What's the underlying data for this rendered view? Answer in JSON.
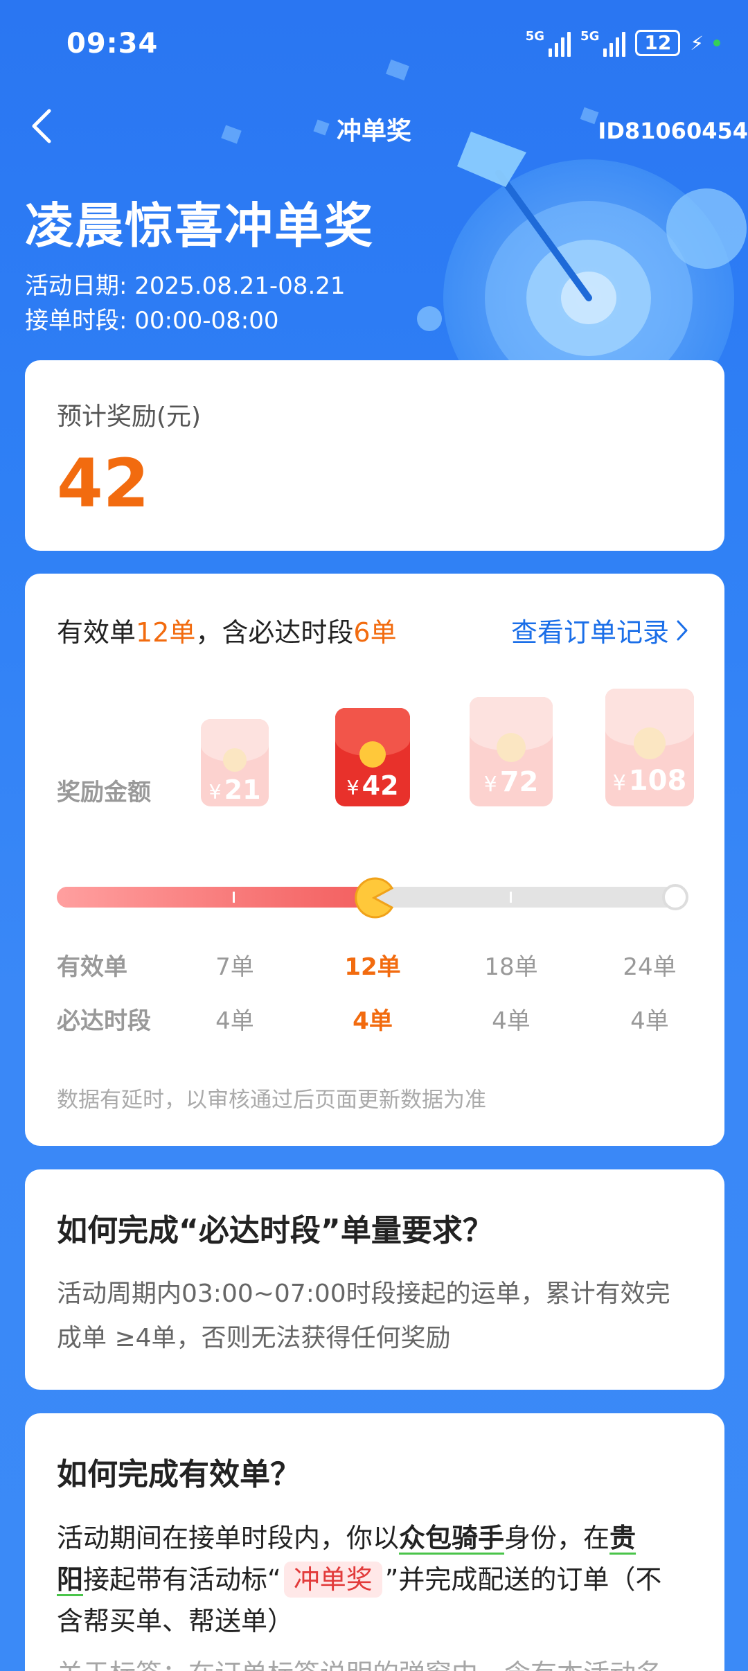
{
  "status_bar": {
    "time": "09:34",
    "signal1_label": "5G",
    "signal2_label": "5G",
    "battery": "12"
  },
  "nav": {
    "title": "冲单奖",
    "id_text": "ID81060454"
  },
  "hero": {
    "title": "凌晨惊喜冲单奖",
    "date_line": "活动日期: 2025.08.21-08.21",
    "period_line": "接单时段: 00:00-08:00"
  },
  "reward": {
    "label": "预计奖励(元)",
    "value": "42"
  },
  "progress": {
    "head_prefix": "有效单",
    "valid_count": "12单",
    "head_mid": "，含必达时段",
    "must_count": "6单",
    "order_link": "查看订单记录",
    "reward_row_label": "奖励金额",
    "valid_row_label": "有效单",
    "must_row_label": "必达时段",
    "current_fraction": 0.5,
    "tiers": [
      {
        "amount": "21",
        "valid": "7单",
        "must": "4单",
        "active": false
      },
      {
        "amount": "42",
        "valid": "12单",
        "must": "4单",
        "active": true
      },
      {
        "amount": "72",
        "valid": "18单",
        "must": "4单",
        "active": false
      },
      {
        "amount": "108",
        "valid": "24单",
        "must": "4单",
        "active": false
      }
    ],
    "yen": "¥",
    "note": "数据有延时，以审核通过后页面更新数据为准"
  },
  "faq1": {
    "title": "如何完成“必达时段”单量要求？",
    "line1": "活动周期内03:00~07:00时段接起的运单，累计有效完",
    "line2": "成单 ≥4单，否则无法获得任何奖励"
  },
  "faq2": {
    "title": "如何完成有效单？",
    "p1_a": "活动期间在接单时段内，你以",
    "p1_b": "众包骑手",
    "p1_c": "身份，在",
    "p1_d": "贵",
    "p2_a": "阳",
    "p2_b": "接起带有活动标“",
    "p2_tag": "冲单奖",
    "p2_c": "”并完成配送的订单（不",
    "p3": "含帮买单、帮送单）",
    "p4_a": "关于标签",
    "p4_b": "：在订单标签说明的弹窗中，含有本活动名"
  },
  "colors": {
    "accent_orange": "#f26b0f",
    "link_blue": "#1a6ee8",
    "bg_blue": "#2f80f5",
    "envelope_red": "#e8312b"
  }
}
